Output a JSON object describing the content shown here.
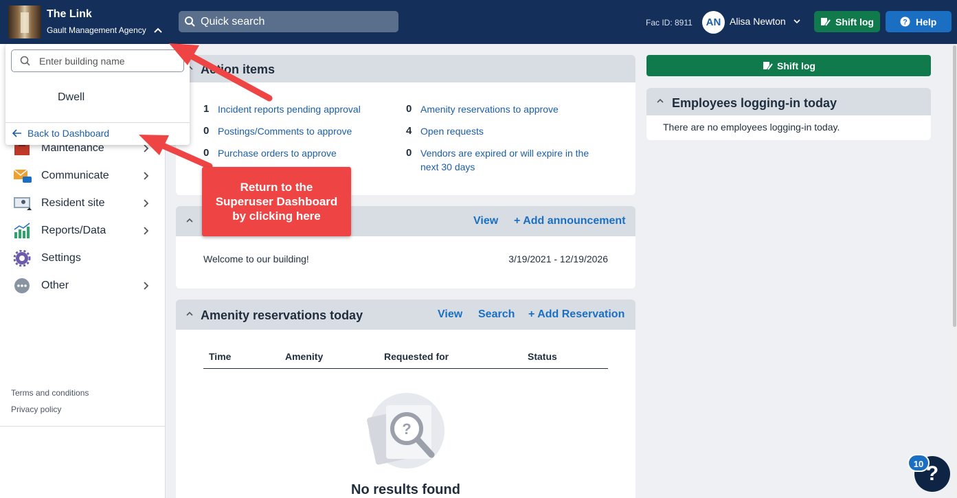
{
  "header": {
    "app_name": "The Link",
    "agency": "Gault Management Agency",
    "search_placeholder": "Quick search",
    "fac_id": "Fac ID: 8911",
    "user_initials": "AN",
    "user_name": "Alisa Newton",
    "shift_log_label": "Shift log",
    "help_label": "Help"
  },
  "dropdown": {
    "placeholder": "Enter building name",
    "items": [
      "Dwell"
    ],
    "back_label": "Back to Dashboard"
  },
  "sidebar": {
    "items": [
      {
        "label": "Maintenance",
        "icon": "toolbox-icon"
      },
      {
        "label": "Communicate",
        "icon": "envelope-chat-icon"
      },
      {
        "label": "Resident site",
        "icon": "monitor-user-icon"
      },
      {
        "label": "Reports/Data",
        "icon": "bar-chart-icon"
      },
      {
        "label": "Settings",
        "icon": "gear-icon"
      },
      {
        "label": "Other",
        "icon": "more-icon"
      }
    ],
    "terms": "Terms and conditions",
    "privacy": "Privacy policy"
  },
  "action_items": {
    "title": "Action items",
    "left": [
      {
        "count": "1",
        "label": "Incident reports pending approval"
      },
      {
        "count": "0",
        "label": "Postings/Comments to approve"
      },
      {
        "count": "0",
        "label": "Purchase orders to approve"
      }
    ],
    "right": [
      {
        "count": "0",
        "label": "Amenity reservations to approve"
      },
      {
        "count": "4",
        "label": "Open requests"
      },
      {
        "count": "0",
        "label": "Vendors are expired or will expire in the next 30 days"
      }
    ]
  },
  "announcements": {
    "view_label": "View",
    "add_label": "+ Add announcement",
    "text": "Welcome to our building!",
    "date_range": "3/19/2021 - 12/19/2026"
  },
  "amenity": {
    "title": "Amenity reservations today",
    "view_label": "View",
    "search_label": "Search",
    "add_label": "+ Add Reservation",
    "columns": [
      "Time",
      "Amenity",
      "Requested for",
      "Status"
    ],
    "empty_text": "No results found"
  },
  "right_panel": {
    "shift_log_label": "Shift log",
    "employees_title": "Employees logging-in today",
    "employees_empty": "There are no employees logging-in today."
  },
  "callout": {
    "lines": [
      "Return to the",
      "Superuser Dashboard",
      "by clicking here"
    ]
  },
  "help_widget": {
    "badge": "10",
    "glyph": "?"
  },
  "colors": {
    "topbar": "#14305a",
    "accent_blue": "#1b6fc2",
    "shift_green": "#117a4d",
    "callout_red": "#ee4444"
  }
}
